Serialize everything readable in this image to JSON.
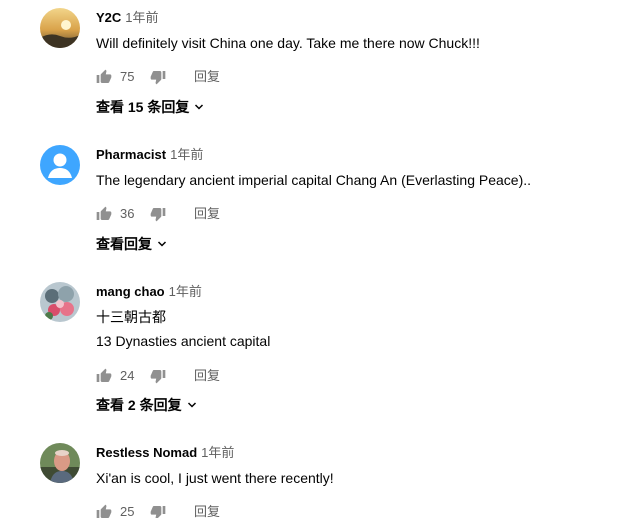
{
  "comments": [
    {
      "author": "Y2C",
      "time": "1年前",
      "lines": [
        "Will definitely visit China one day. Take me there now Chuck!!!"
      ],
      "likes": "75",
      "reply_label": "回复",
      "view_replies": "查看 15 条回复",
      "avatar": "sunset-photo-avatar"
    },
    {
      "author": "Pharmacist",
      "time": "1年前",
      "lines": [
        "The legendary ancient imperial capital Chang An (Everlasting Peace).."
      ],
      "likes": "36",
      "reply_label": "回复",
      "view_replies": "查看回复",
      "avatar": "default-person-avatar"
    },
    {
      "author": "mang chao",
      "time": "1年前",
      "lines": [
        "十三朝古都",
        "13 Dynasties ancient capital"
      ],
      "likes": "24",
      "reply_label": "回复",
      "view_replies": "查看 2 条回复",
      "avatar": "flower-photo-avatar"
    },
    {
      "author": "Restless Nomad",
      "time": "1年前",
      "lines": [
        "Xi'an is cool, I just went there recently!"
      ],
      "likes": "25",
      "reply_label": "回复",
      "avatar": "person-photo-avatar"
    }
  ],
  "colors": {
    "text_primary": "#030303",
    "text_secondary": "#606060",
    "icon": "#909090",
    "default_avatar_bg": "#3ea6ff"
  }
}
